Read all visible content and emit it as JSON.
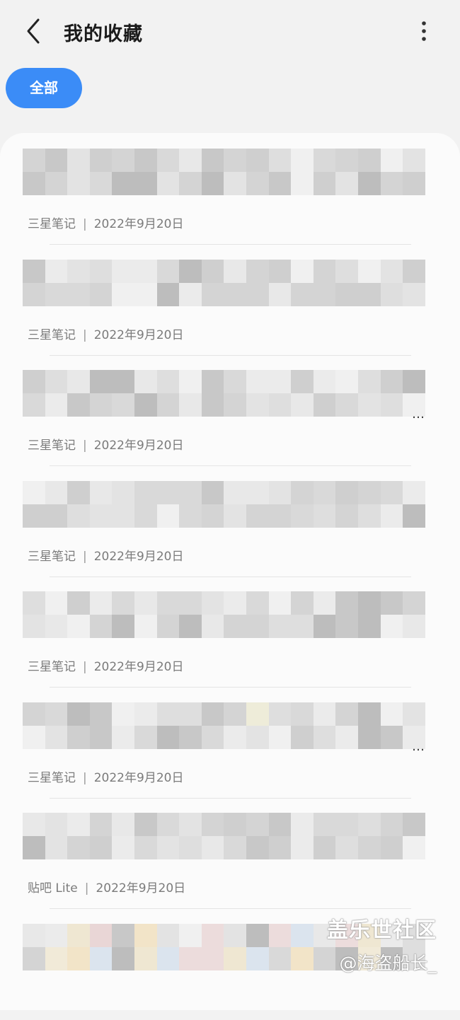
{
  "header": {
    "title": "我的收藏",
    "back_icon": "chevron-left-icon",
    "more_icon": "more-vertical-icon"
  },
  "filter": {
    "chip_label": "全部"
  },
  "items": [
    {
      "source": "三星笔记",
      "date": "2022年9月20日",
      "has_ellipsis": false
    },
    {
      "source": "三星笔记",
      "date": "2022年9月20日",
      "has_ellipsis": false
    },
    {
      "source": "三星笔记",
      "date": "2022年9月20日",
      "has_ellipsis": true
    },
    {
      "source": "三星笔记",
      "date": "2022年9月20日",
      "has_ellipsis": false
    },
    {
      "source": "三星笔记",
      "date": "2022年9月20日",
      "has_ellipsis": false
    },
    {
      "source": "三星笔记",
      "date": "2022年9月20日",
      "has_ellipsis": true
    },
    {
      "source": "贴吧 Lite",
      "date": "2022年9月20日",
      "has_ellipsis": false
    },
    {
      "source": "",
      "date": "",
      "has_ellipsis": false
    }
  ],
  "separator": "|",
  "watermark": {
    "line1": "盖乐世社区",
    "line2": "@海盗船长_"
  },
  "colors": {
    "accent": "#3b8cf7",
    "background": "#f2f2f2",
    "card": "#fbfbfb"
  }
}
